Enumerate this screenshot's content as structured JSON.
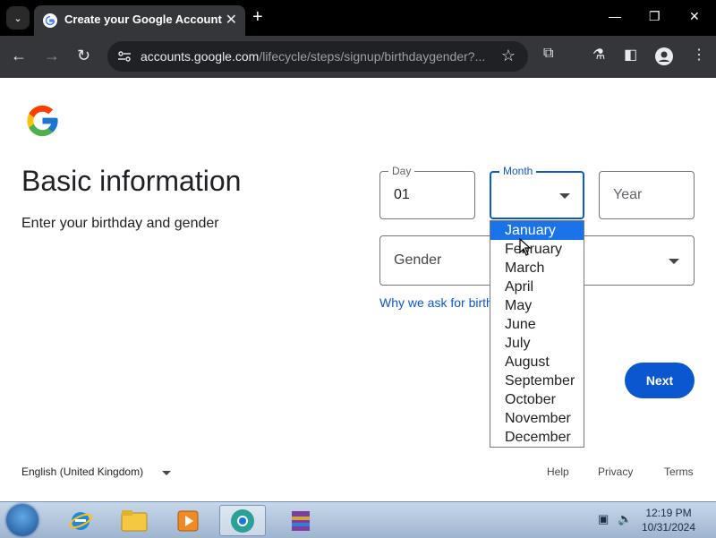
{
  "browser": {
    "tab_title": "Create your Google Account",
    "url_host": "accounts.google.com",
    "url_path": "/lifecycle/steps/signup/birthdaygender?..."
  },
  "page": {
    "title": "Basic information",
    "subtitle": "Enter your birthday and gender",
    "day": {
      "label": "Day",
      "value": "01"
    },
    "month": {
      "label": "Month",
      "options": [
        "January",
        "February",
        "March",
        "April",
        "May",
        "June",
        "July",
        "August",
        "September",
        "October",
        "November",
        "December"
      ],
      "highlighted": "January"
    },
    "year": {
      "placeholder": "Year"
    },
    "gender": {
      "placeholder": "Gender"
    },
    "why_link": "Why we ask for birthday and gender",
    "next_label": "Next"
  },
  "footer": {
    "language": "English (United Kingdom)",
    "help": "Help",
    "privacy": "Privacy",
    "terms": "Terms"
  },
  "taskbar": {
    "time": "12:19 PM",
    "date": "10/31/2024"
  },
  "colors": {
    "accent": "#0b57d0",
    "highlight": "#1a73e8",
    "chrome_dark": "#35363a"
  },
  "icons": [
    "tab-search-icon",
    "google-favicon",
    "close-icon",
    "new-tab-icon",
    "minimize-icon",
    "maximize-icon",
    "window-close-icon",
    "back-icon",
    "forward-icon",
    "reload-icon",
    "site-info-icon",
    "bookmark-star-icon",
    "extensions-icon",
    "labs-icon",
    "side-panel-icon",
    "profile-icon",
    "menu-icon",
    "google-logo",
    "start-icon",
    "ie-icon",
    "explorer-icon",
    "media-player-icon",
    "chrome-app-icon",
    "winrar-icon",
    "network-icon",
    "volume-icon"
  ]
}
